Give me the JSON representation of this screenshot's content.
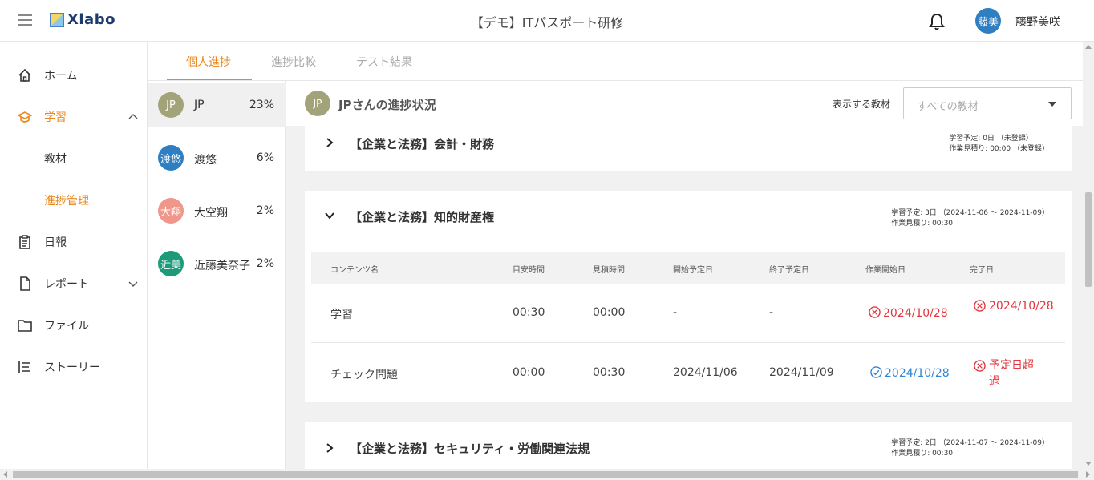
{
  "header": {
    "logo_text": "Xlabo",
    "title": "【デモ】ITパスポート研修",
    "user_avatar": "藤美",
    "user_name": "藤野美咲"
  },
  "sidebar": {
    "items": [
      {
        "label": "ホーム",
        "icon": "home-icon"
      },
      {
        "label": "学習",
        "icon": "graduation-cap-icon"
      },
      {
        "label": "教材"
      },
      {
        "label": "進捗管理"
      },
      {
        "label": "日報",
        "icon": "clipboard-icon"
      },
      {
        "label": "レポート",
        "icon": "document-icon"
      },
      {
        "label": "ファイル",
        "icon": "folder-icon"
      },
      {
        "label": "ストーリー",
        "icon": "list-icon"
      }
    ]
  },
  "tabs": [
    {
      "label": "個人進捗"
    },
    {
      "label": "進捗比較"
    },
    {
      "label": "テスト結果"
    }
  ],
  "students": [
    {
      "initials": "JP",
      "name": "JP",
      "percent": "23%",
      "color": "#a3a37a"
    },
    {
      "initials": "渡悠",
      "name": "渡悠",
      "percent": "6%",
      "color": "#2f7ec1"
    },
    {
      "initials": "大翔",
      "name": "大空翔",
      "percent": "2%",
      "color": "#f0968a"
    },
    {
      "initials": "近美",
      "name": "近藤美奈子",
      "percent": "2%",
      "color": "#1d9a7a"
    }
  ],
  "main": {
    "avatar": "JP",
    "title": "JPさんの進捗状況",
    "filter_label": "表示する教材",
    "filter_placeholder": "すべての教材"
  },
  "cards": [
    {
      "title": "【企業と法務】会計・財務",
      "meta1": "学習予定: 0日 （未登録）",
      "meta2": "作業見積り: 00:00 （未登録）",
      "expanded": false
    },
    {
      "title": "【企業と法務】知的財産権",
      "meta1": "学習予定: 3日 （2024-11-06 〜 2024-11-09）",
      "meta2": "作業見積り: 00:30",
      "expanded": true,
      "columns": [
        "コンテンツ名",
        "目安時間",
        "見積時間",
        "開始予定日",
        "終了予定日",
        "作業開始日",
        "完了日"
      ],
      "rows": [
        {
          "name": "学習",
          "target": "00:30",
          "estimate": "00:00",
          "start_plan": "-",
          "end_plan": "-",
          "work_start": "2024/10/28",
          "work_start_status": "error",
          "done": "2024/10/28",
          "done_status": "error"
        },
        {
          "name": "チェック問題",
          "target": "00:00",
          "estimate": "00:30",
          "start_plan": "2024/11/06",
          "end_plan": "2024/11/09",
          "work_start": "2024/10/28",
          "work_start_status": "ok",
          "done": "予定日超過",
          "done_status": "error"
        }
      ]
    },
    {
      "title": "【企業と法務】セキュリティ・労働関連法規",
      "meta1": "学習予定: 2日 （2024-11-07 〜 2024-11-09）",
      "meta2": "作業見積り: 00:30",
      "expanded": false
    }
  ],
  "colors": {
    "accent": "#e8891e",
    "error": "#e0383e",
    "ok": "#2f85d6"
  }
}
